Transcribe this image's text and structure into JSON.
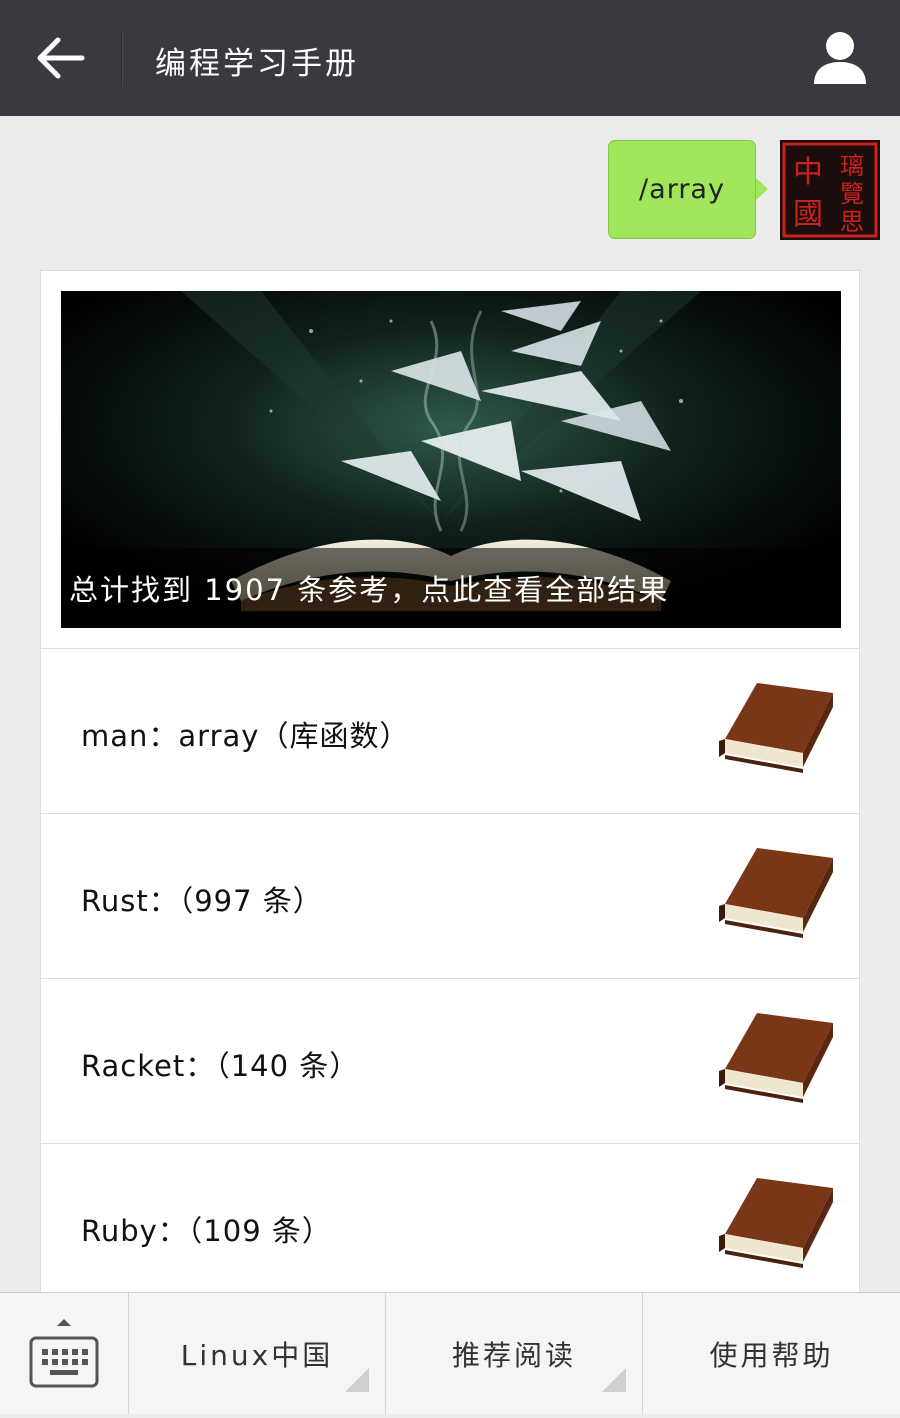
{
  "header": {
    "title": "编程学习手册"
  },
  "message": {
    "text": "/array",
    "avatar_chars": [
      "中",
      "璃",
      "覽",
      "國",
      "思"
    ]
  },
  "card": {
    "cover_caption": "总计找到 1907 条参考，点此查看全部结果",
    "items": [
      {
        "label": "man：array（库函数）"
      },
      {
        "label": "Rust：（997 条）"
      },
      {
        "label": "Racket：（140 条）"
      },
      {
        "label": "Ruby：（109 条）"
      }
    ]
  },
  "menu": {
    "items": [
      {
        "label": "Linux中国"
      },
      {
        "label": "推荐阅读"
      },
      {
        "label": "使用帮助"
      }
    ]
  },
  "colors": {
    "header_bg": "#393a3f",
    "bubble_bg": "#9fe65a",
    "page_bg": "#ebebeb",
    "seal_red": "#c8211e"
  }
}
